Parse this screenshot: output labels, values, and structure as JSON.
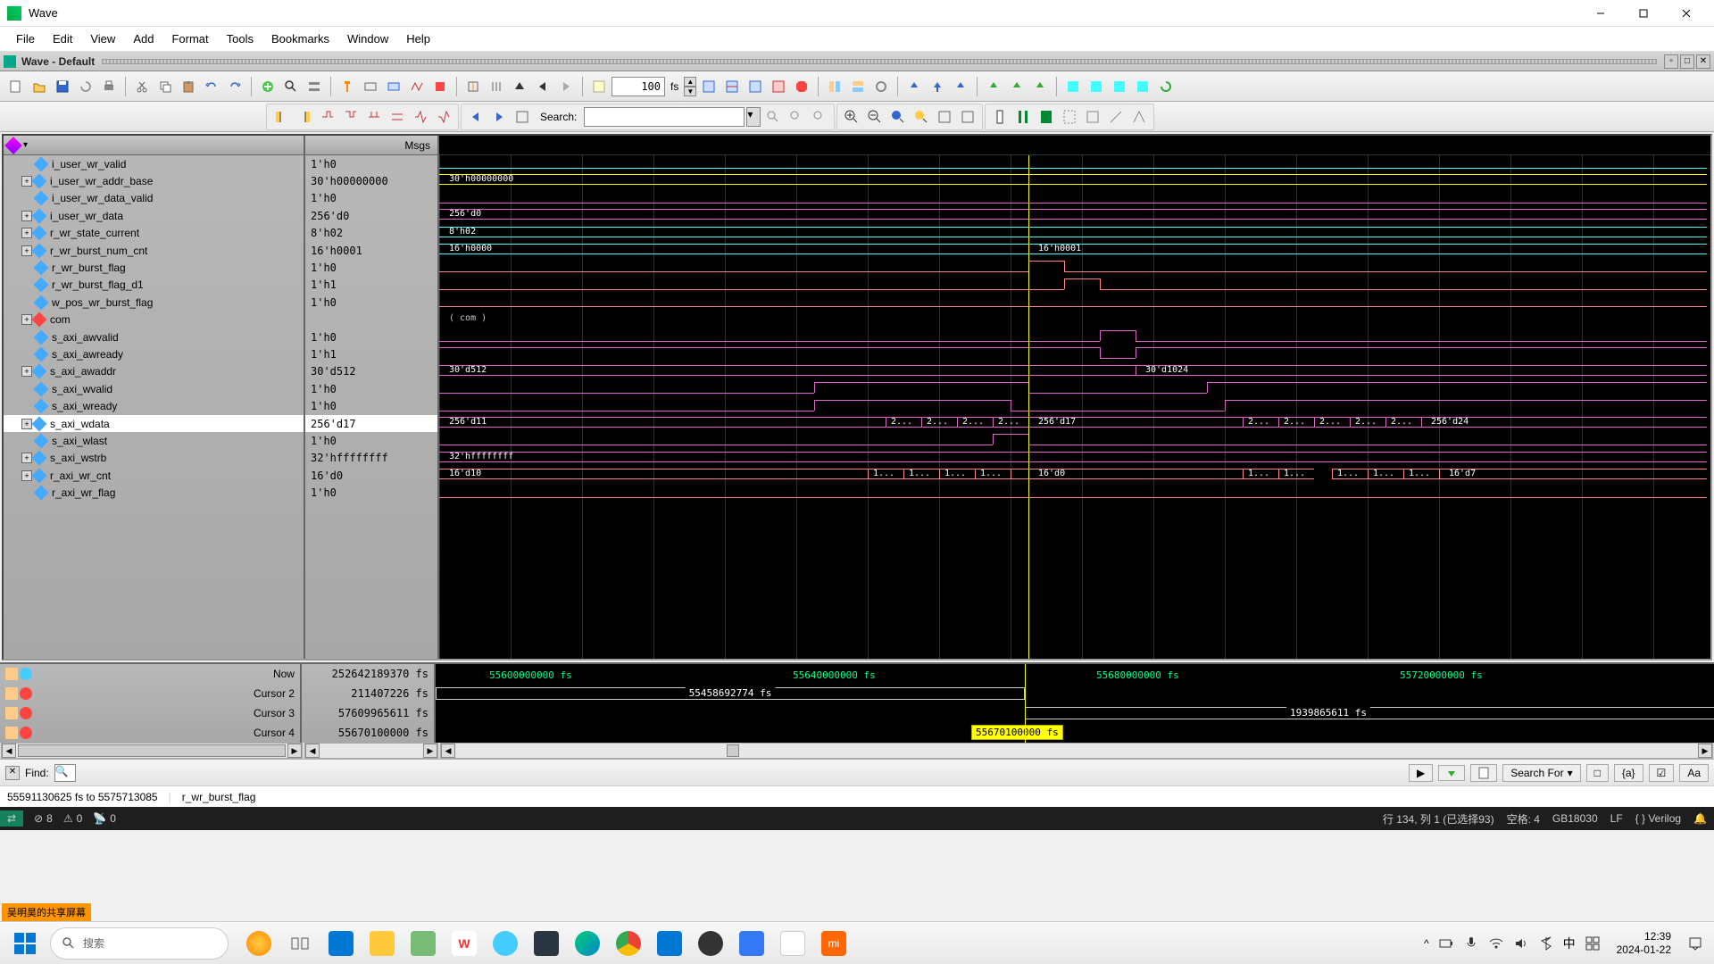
{
  "window": {
    "title": "Wave"
  },
  "menu": [
    "File",
    "Edit",
    "View",
    "Add",
    "Format",
    "Tools",
    "Bookmarks",
    "Window",
    "Help"
  ],
  "tab": {
    "label": "Wave - Default"
  },
  "toolbar": {
    "time_value": "100",
    "time_unit": "fs"
  },
  "toolbar2": {
    "search_label": "Search:"
  },
  "headers": {
    "msgs": "Msgs"
  },
  "signals": [
    {
      "name": "i_user_wr_valid",
      "msg": "1'h0",
      "exp": false
    },
    {
      "name": "i_user_wr_addr_base",
      "msg": "30'h00000000",
      "exp": true
    },
    {
      "name": "i_user_wr_data_valid",
      "msg": "1'h0",
      "exp": false
    },
    {
      "name": "i_user_wr_data",
      "msg": "256'd0",
      "exp": true
    },
    {
      "name": "r_wr_state_current",
      "msg": "8'h02",
      "exp": true
    },
    {
      "name": "r_wr_burst_num_cnt",
      "msg": "16'h0001",
      "exp": true
    },
    {
      "name": "r_wr_burst_flag",
      "msg": "1'h0",
      "exp": false
    },
    {
      "name": "r_wr_burst_flag_d1",
      "msg": "1'h1",
      "exp": false
    },
    {
      "name": "w_pos_wr_burst_flag",
      "msg": "1'h0",
      "exp": false
    },
    {
      "name": "com",
      "msg": "",
      "exp": true,
      "red": true
    },
    {
      "name": "s_axi_awvalid",
      "msg": "1'h0",
      "exp": false
    },
    {
      "name": "s_axi_awready",
      "msg": "1'h1",
      "exp": false
    },
    {
      "name": "s_axi_awaddr",
      "msg": "30'd512",
      "exp": true
    },
    {
      "name": "s_axi_wvalid",
      "msg": "1'h0",
      "exp": false
    },
    {
      "name": "s_axi_wready",
      "msg": "1'h0",
      "exp": false
    },
    {
      "name": "s_axi_wdata",
      "msg": "256'd17",
      "exp": true,
      "selected": true
    },
    {
      "name": "s_axi_wlast",
      "msg": "1'h0",
      "exp": false
    },
    {
      "name": "s_axi_wstrb",
      "msg": "32'hffffffff",
      "exp": true
    },
    {
      "name": "r_axi_wr_cnt",
      "msg": "16'd0",
      "exp": true
    },
    {
      "name": "r_axi_wr_flag",
      "msg": "1'h0",
      "exp": false
    }
  ],
  "wave_labels": {
    "addr_base": "30'h00000000",
    "wr_data": "256'd0",
    "state": "8'h02",
    "burst_cnt_0": "16'h0000",
    "burst_cnt_1": "16'h0001",
    "com": "( com )",
    "awaddr_0": "30'd512",
    "awaddr_1": "30'd1024",
    "wdata_0": "256'd11",
    "wdata_mid": "256'd17",
    "wdata_end": "256'd24",
    "wdata_seg": "2...",
    "wstrb": "32'hffffffff",
    "wr_cnt_0": "16'd10",
    "wr_cnt_mid": "16'd0",
    "wr_cnt_end": "16'd7",
    "wr_cnt_seg": "1..."
  },
  "cursors": {
    "now_label": "Now",
    "now_val": "252642189370 fs",
    "c2_label": "Cursor 2",
    "c2_val": "211407226 fs",
    "c3_label": "Cursor 3",
    "c3_val": "57609965611 fs",
    "c4_label": "Cursor 4",
    "c4_val": "55670100000 fs"
  },
  "timescale": {
    "t1": "55600000000 fs",
    "t2": "55640000000 fs",
    "t3": "55680000000 fs",
    "t4": "55720000000 fs",
    "delta1": "55458692774 fs",
    "delta2": "1939865611 fs",
    "c4box": "55670100000 fs"
  },
  "findbar": {
    "label": "Find:",
    "searchfor": "Search For"
  },
  "status": {
    "range": "55591130625 fs to 5575713085",
    "signal": "r_wr_burst_flag"
  },
  "vscode": {
    "errors": "8",
    "warnings": "0",
    "ports": "0",
    "pos": "行 134, 列 1 (已选择93)",
    "spaces": "空格: 4",
    "encoding": "GB18030",
    "eol": "LF",
    "lang": "Verilog"
  },
  "taskbar": {
    "search_placeholder": "搜索",
    "clock_time": "12:39",
    "clock_date": "2024-01-22",
    "ime": "中"
  },
  "sharebadge": "吴明昊的共享屏幕"
}
